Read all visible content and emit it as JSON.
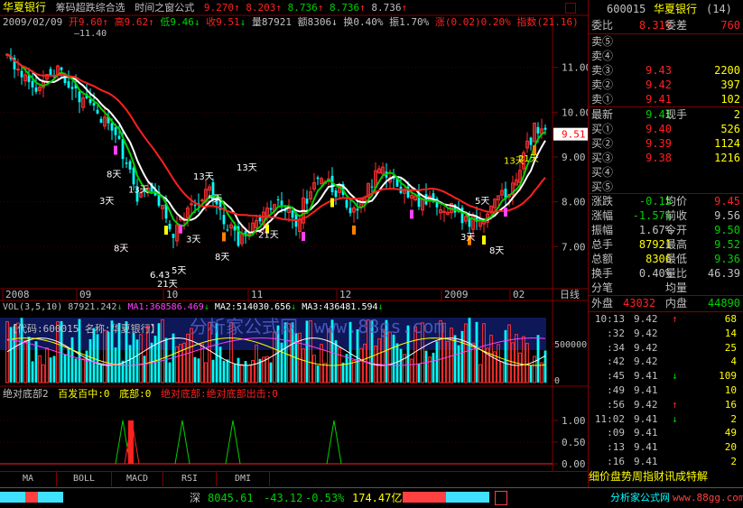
{
  "header": {
    "stock_name": "华夏银行",
    "formula": "筹码超跌综合选",
    "window_label": "时间之窗公式",
    "ma_vals": [
      "9.270",
      "8.203",
      "8.736",
      "8.736",
      "8.736"
    ],
    "date": "2009/02/09",
    "open_label": "开",
    "open": "9.60",
    "high_label": "高",
    "high": "9.62",
    "low_label": "低",
    "low": "9.46",
    "close_label": "收",
    "close": "9.51",
    "vol_label": "量",
    "vol": "87921",
    "amt_label": "额",
    "amt": "8306",
    "turn_label": "换",
    "turn": "0.40%",
    "amp_label": "振",
    "amp": "1.70%",
    "chg_label": "涨",
    "chg": "(0.02)",
    "chg_pct": "0.20%",
    "idx_label": "指数",
    "idx": "(21.16)",
    "peak_label": "11.40",
    "peak_prefix": "—"
  },
  "chart_data": [
    {
      "type": "candlestick",
      "title": "",
      "y_ticks": [
        "11.00",
        "10.00",
        "9.00",
        "8.00",
        "7.00"
      ],
      "ylim": [
        6.1,
        11.9
      ],
      "x_labels": [
        "2008",
        "09",
        "10",
        "11",
        "12",
        "2009",
        "02",
        "日线"
      ],
      "last_price": "9.51",
      "annotations": [
        "8天",
        "3天",
        "13天",
        "8天",
        "13天",
        "3天",
        "5天",
        "21天",
        "6.43",
        "5天",
        "8天",
        "13天",
        "21天",
        "5天",
        "3天",
        "8天",
        "13天",
        "21天"
      ],
      "ma_colors": [
        "#ffffff",
        "#00d000",
        "#ff2020",
        "#c8a000"
      ]
    },
    {
      "type": "bar",
      "title": "VOL(3,5,10)",
      "values_text": [
        "87921.242",
        "MA1:368586.469",
        "MA2:514030.656",
        "MA3:436481.594"
      ],
      "y_ticks": [
        "500000",
        "0"
      ]
    },
    {
      "type": "bar",
      "title": "绝对底部2",
      "series_labels": [
        "百发百中:0",
        "底部:0",
        "绝对底部:绝对底部出击:0"
      ],
      "y_ticks": [
        "1.00",
        "0.50",
        "0.00"
      ]
    }
  ],
  "watermark": {
    "text": "分析家公式网",
    "url": "www.88gs.com",
    "code_label": "【代码:600015  名称:华夏银行】"
  },
  "quote": {
    "code": "600015",
    "name": "华夏银行",
    "num": "(14)",
    "wb_label": "委比",
    "wb": "8.31%",
    "wc_label": "委差",
    "wc": "760",
    "sell": [
      {
        "label": "卖⑤",
        "price": "",
        "vol": ""
      },
      {
        "label": "卖④",
        "price": "",
        "vol": ""
      },
      {
        "label": "卖③",
        "price": "9.43",
        "vol": "2200"
      },
      {
        "label": "卖②",
        "price": "9.42",
        "vol": "397"
      },
      {
        "label": "卖①",
        "price": "9.41",
        "vol": "102"
      }
    ],
    "latest_label": "最新",
    "latest": "9.41",
    "cur_label": "现手",
    "cur": "2",
    "buy": [
      {
        "label": "买①",
        "price": "9.40",
        "vol": "526"
      },
      {
        "label": "买②",
        "price": "9.39",
        "vol": "1124"
      },
      {
        "label": "买③",
        "price": "9.38",
        "vol": "1216"
      },
      {
        "label": "买④",
        "price": "",
        "vol": ""
      },
      {
        "label": "买⑤",
        "price": "",
        "vol": ""
      }
    ],
    "stats": [
      {
        "l1": "涨跌",
        "v1": "-0.15",
        "l2": "均价",
        "v2": "9.45"
      },
      {
        "l1": "涨幅",
        "v1": "-1.57%",
        "l2": "前收",
        "v2": "9.56"
      },
      {
        "l1": "振幅",
        "v1": "1.67%",
        "l2": "今开",
        "v2": "9.50"
      },
      {
        "l1": "总手",
        "v1": "87921",
        "l2": "最高",
        "v2": "9.52"
      },
      {
        "l1": "总额",
        "v1": "8306",
        "l2": "最低",
        "v2": "9.36"
      },
      {
        "l1": "换手",
        "v1": "0.40%",
        "l2": "量比",
        "v2": "46.39"
      },
      {
        "l1": "分笔",
        "v1": "",
        "l2": "均量",
        "v2": ""
      }
    ],
    "outer_label": "外盘",
    "outer": "43032",
    "inner_label": "内盘",
    "inner": "44890"
  },
  "ticks": [
    {
      "t": "10:13",
      "p": "9.42",
      "d": "↑",
      "v": "68"
    },
    {
      "t": ":32",
      "p": "9.42",
      "d": "",
      "v": "14"
    },
    {
      "t": ":34",
      "p": "9.42",
      "d": "",
      "v": "25"
    },
    {
      "t": ":42",
      "p": "9.42",
      "d": "",
      "v": "4"
    },
    {
      "t": ":45",
      "p": "9.41",
      "d": "↓",
      "v": "109"
    },
    {
      "t": ":49",
      "p": "9.41",
      "d": "",
      "v": "10"
    },
    {
      "t": ":56",
      "p": "9.42",
      "d": "↑",
      "v": "16"
    },
    {
      "t": "11:02",
      "p": "9.41",
      "d": "↓",
      "v": "2"
    },
    {
      "t": ":09",
      "p": "9.41",
      "d": "",
      "v": "49"
    },
    {
      "t": ":13",
      "p": "9.41",
      "d": "",
      "v": "20"
    },
    {
      "t": ":16",
      "p": "9.41",
      "d": "",
      "v": "2"
    }
  ],
  "ticker_ad": "细价盘势周指财讯成特解",
  "tabs": [
    "MA",
    "BOLL",
    "MACD",
    "RSI",
    "DMI"
  ],
  "status": {
    "market": "深",
    "index": "8045.61",
    "change": "-43.12",
    "pct": "-0.53%",
    "amount": "174.47亿",
    "watermark": "分析家公式网",
    "url": "www.88gg.com"
  }
}
